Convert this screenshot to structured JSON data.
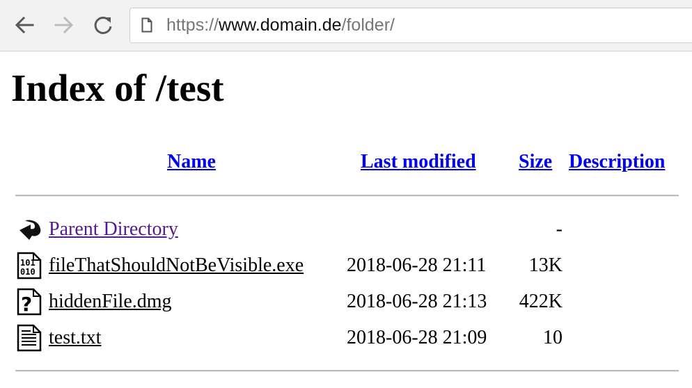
{
  "browser": {
    "url_scheme": "https://",
    "url_host": "www.domain.de",
    "url_path": "/folder/",
    "back_icon": "arrow-left-icon",
    "forward_icon": "arrow-right-icon",
    "reload_icon": "reload-icon",
    "page_icon": "page-icon"
  },
  "page": {
    "title": "Index of /test",
    "columns": {
      "name": "Name",
      "last_modified": "Last modified",
      "size": "Size",
      "description": "Description"
    },
    "rows": [
      {
        "icon": "back-arrow-icon",
        "name": "Parent Directory",
        "modified": "",
        "size": "-"
      },
      {
        "icon": "binary-file-icon",
        "name": "fileThatShouldNotBeVisible.exe",
        "modified": "2018-06-28 21:11",
        "size": "13K"
      },
      {
        "icon": "unknown-file-icon",
        "name": "hiddenFile.dmg",
        "modified": "2018-06-28 21:13",
        "size": "422K"
      },
      {
        "icon": "text-file-icon",
        "name": "test.txt",
        "modified": "2018-06-28 21:09",
        "size": "10"
      }
    ]
  }
}
